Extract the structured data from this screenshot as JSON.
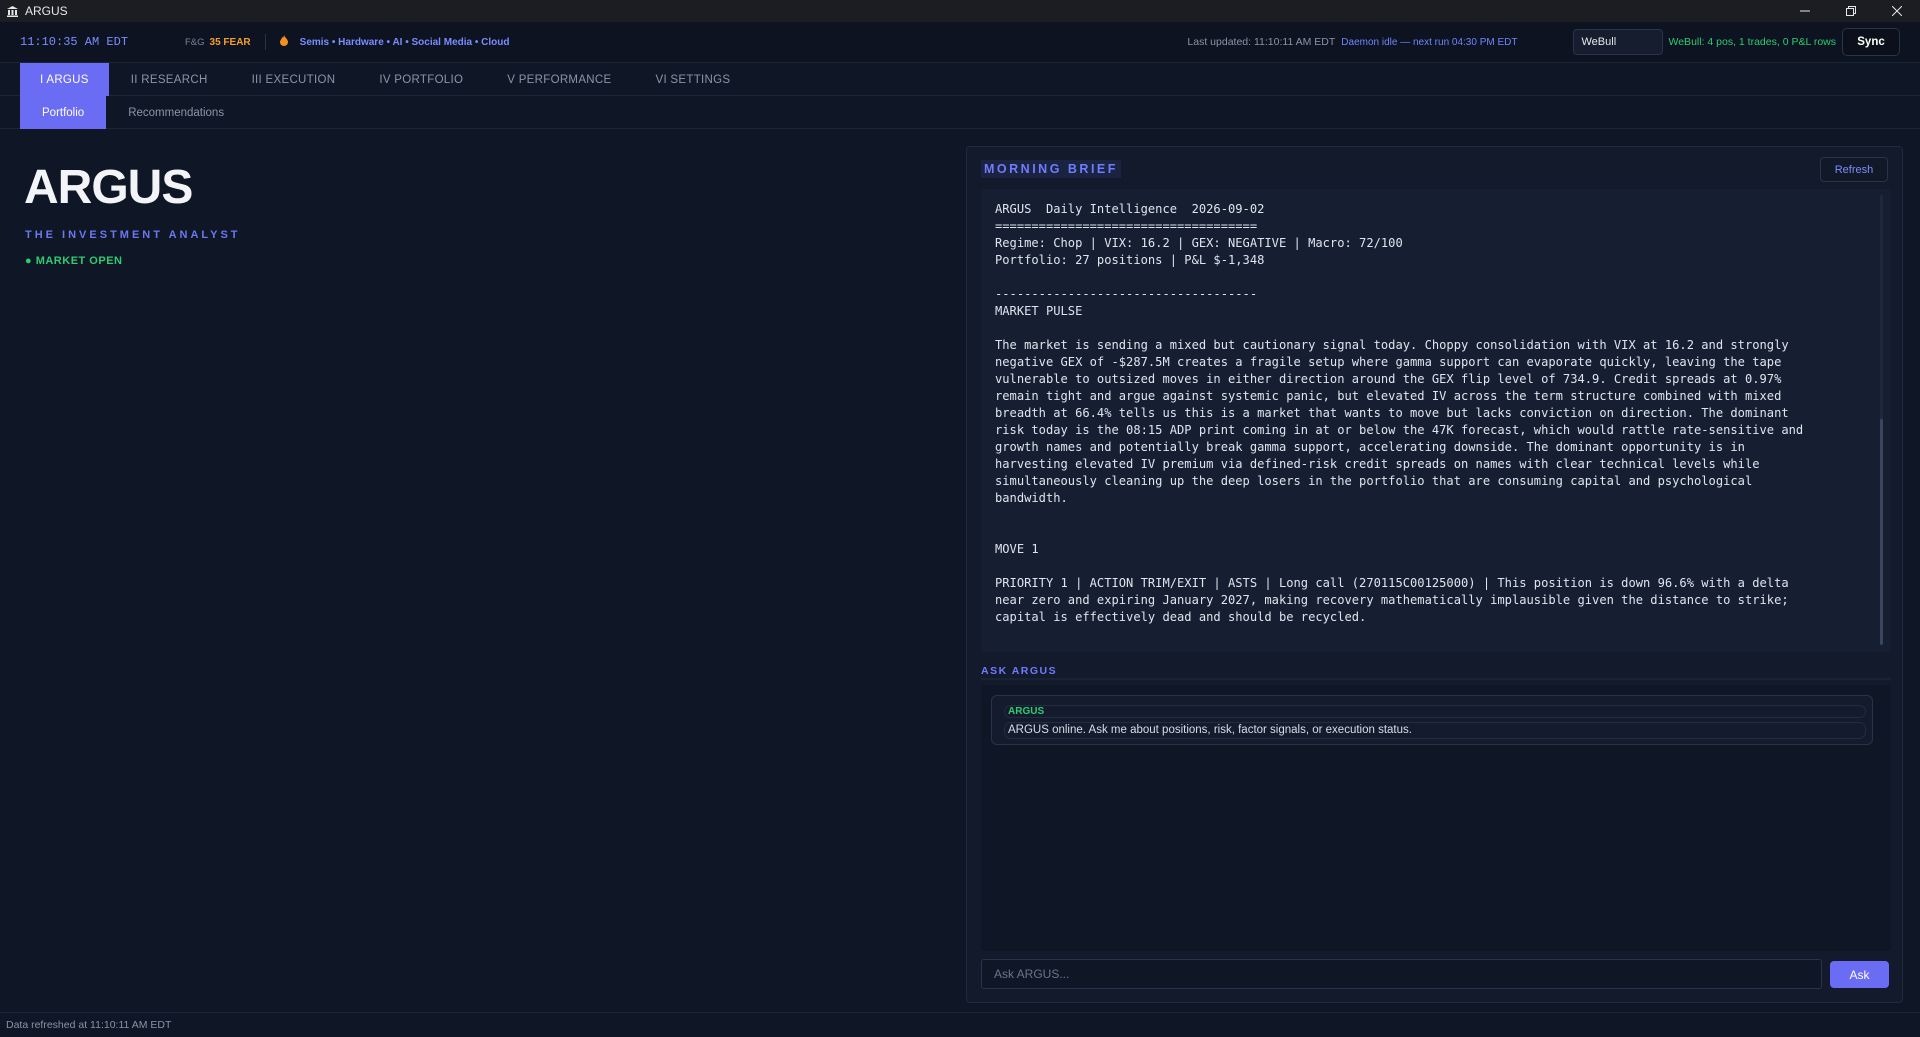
{
  "window": {
    "title": "ARGUS"
  },
  "status_bar": {
    "clock": "11:10:35 AM EDT",
    "fear_greed_label": "F&G",
    "fear_greed_value": "35 FEAR",
    "sectors": "Semis • Hardware • AI • Social Media • Cloud",
    "last_updated": "Last updated: 11:10:11 AM EDT",
    "daemon_status": "Daemon idle — next run 04:30 PM EDT",
    "broker_selected": "WeBull",
    "broker_status": "WeBull: 4 pos, 1 trades, 0 P&L rows",
    "sync_label": "Sync"
  },
  "nav": {
    "tabs": [
      {
        "label": "I  ARGUS",
        "active": true
      },
      {
        "label": "II  RESEARCH",
        "active": false
      },
      {
        "label": "III  EXECUTION",
        "active": false
      },
      {
        "label": "IV  PORTFOLIO",
        "active": false
      },
      {
        "label": "V  PERFORMANCE",
        "active": false
      },
      {
        "label": "VI  SETTINGS",
        "active": false
      }
    ],
    "subtabs": [
      {
        "label": "Portfolio",
        "active": true
      },
      {
        "label": "Recommendations",
        "active": false
      }
    ]
  },
  "hero": {
    "title": "ARGUS",
    "subtitle": "THE INVESTMENT ANALYST",
    "market_status": "● MARKET OPEN"
  },
  "brief": {
    "label": "MORNING BRIEF",
    "refresh_label": "Refresh",
    "text": "ARGUS  Daily Intelligence  2026-09-02\n====================================\nRegime: Chop | VIX: 16.2 | GEX: NEGATIVE | Macro: 72/100\nPortfolio: 27 positions | P&L $-1,348\n\n------------------------------------\nMARKET PULSE\n\nThe market is sending a mixed but cautionary signal today. Choppy consolidation with VIX at 16.2 and strongly\nnegative GEX of -$287.5M creates a fragile setup where gamma support can evaporate quickly, leaving the tape\nvulnerable to outsized moves in either direction around the GEX flip level of 734.9. Credit spreads at 0.97%\nremain tight and argue against systemic panic, but elevated IV across the term structure combined with mixed\nbreadth at 66.4% tells us this is a market that wants to move but lacks conviction on direction. The dominant\nrisk today is the 08:15 ADP print coming in at or below the 47K forecast, which would rattle rate-sensitive and\ngrowth names and potentially break gamma support, accelerating downside. The dominant opportunity is in\nharvesting elevated IV premium via defined-risk credit spreads on names with clear technical levels while\nsimultaneously cleaning up the deep losers in the portfolio that are consuming capital and psychological\nbandwidth.\n\n\nMOVE 1\n\nPRIORITY 1 | ACTION TRIM/EXIT | ASTS | Long call (270115C00125000) | This position is down 96.6% with a delta\nnear zero and expiring January 2027, making recovery mathematically implausible given the distance to strike;\ncapital is effectively dead and should be recycled."
  },
  "ask": {
    "label": "ASK ARGUS",
    "message_sender": "ARGUS",
    "message_text": "ARGUS online. Ask me about positions, risk, factor signals, or execution status.",
    "input_placeholder": "Ask ARGUS...",
    "button_label": "Ask"
  },
  "footer": {
    "text": "Data refreshed at 11:10:11 AM EDT"
  }
}
